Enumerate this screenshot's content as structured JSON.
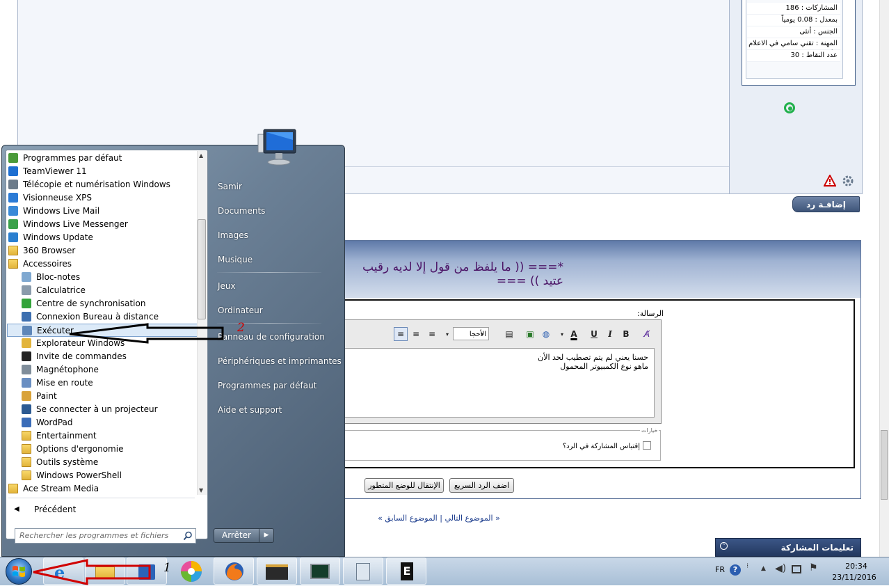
{
  "forum": {
    "member_info": [
      "المشاركات : 186",
      "بمعدل : 0.08 يومياً",
      "الجنس : أنثى",
      "المهنة : تقني سامي في الاعلام الألي",
      "عدد النقاط : 30"
    ],
    "reply_button": "إضافـة رد",
    "quick_reply_title": "*=== (( ما يلفظ من قول إلا لديه رقيب عتيد )) ===",
    "message_label": "الرسالة:",
    "font_select": "الأحجا",
    "message_lines": [
      "حسنا يعني لم يتم تصطيب لحد الأن",
      "ماهو نوع الكمبيوتر المحمول"
    ],
    "options_legend": "خيارات",
    "quote_option": "إقتباس المشاركة في الرد؟",
    "quick_reply_button": "اضف الرد السريع",
    "advanced_mode_button": "الإنتقال للوضع المتطور",
    "prev_topic": "الموضوع السابق",
    "next_topic": "الموضوع التالي",
    "instructions_header": "تعليمات المشاركة"
  },
  "start_menu": {
    "programs": [
      {
        "label": "Programmes par défaut",
        "icon": "default-programs-icon"
      },
      {
        "label": "TeamViewer 11",
        "icon": "teamviewer-icon"
      },
      {
        "label": "Télécopie et numérisation Windows",
        "icon": "fax-icon"
      },
      {
        "label": "Visionneuse XPS",
        "icon": "xps-icon"
      },
      {
        "label": "Windows Live Mail",
        "icon": "mail-icon"
      },
      {
        "label": "Windows Live Messenger",
        "icon": "messenger-icon"
      },
      {
        "label": "Windows Update",
        "icon": "update-icon"
      },
      {
        "label": "360 Browser",
        "icon": "folder-icon"
      },
      {
        "label": "Accessoires",
        "icon": "folder-icon"
      },
      {
        "label": "Bloc-notes",
        "icon": "notepad-icon"
      },
      {
        "label": "Calculatrice",
        "icon": "calculator-icon"
      },
      {
        "label": "Centre de synchronisation",
        "icon": "sync-icon"
      },
      {
        "label": "Connexion Bureau à distance",
        "icon": "remote-desktop-icon"
      },
      {
        "label": "Exécuter",
        "icon": "run-icon"
      },
      {
        "label": "Explorateur Windows",
        "icon": "explorer-icon"
      },
      {
        "label": "Invite de commandes",
        "icon": "cmd-icon"
      },
      {
        "label": "Magnétophone",
        "icon": "recorder-icon"
      },
      {
        "label": "Mise en route",
        "icon": "getting-started-icon"
      },
      {
        "label": "Paint",
        "icon": "paint-icon"
      },
      {
        "label": "Se connecter à un projecteur",
        "icon": "projector-icon"
      },
      {
        "label": "WordPad",
        "icon": "wordpad-icon"
      },
      {
        "label": "Entertainment",
        "icon": "folder-icon"
      },
      {
        "label": "Options d'ergonomie",
        "icon": "folder-icon"
      },
      {
        "label": "Outils système",
        "icon": "folder-icon"
      },
      {
        "label": "Windows PowerShell",
        "icon": "folder-icon"
      },
      {
        "label": "Ace Stream Media",
        "icon": "folder-icon"
      }
    ],
    "back": "Précédent",
    "search_placeholder": "Rechercher les programmes et fichiers",
    "right_items": [
      "Samir",
      "Documents",
      "Images",
      "Musique",
      "Jeux",
      "Ordinateur",
      "Panneau de configuration",
      "Périphériques et imprimantes",
      "Programmes par défaut",
      "Aide et support"
    ],
    "shutdown": "Arrêter"
  },
  "taskbar": {
    "language": "FR",
    "time": "20:34",
    "date": "23/11/2016"
  },
  "annotations": {
    "step_1": "1",
    "step_2": "2",
    "arrow_color": "#d00000"
  }
}
